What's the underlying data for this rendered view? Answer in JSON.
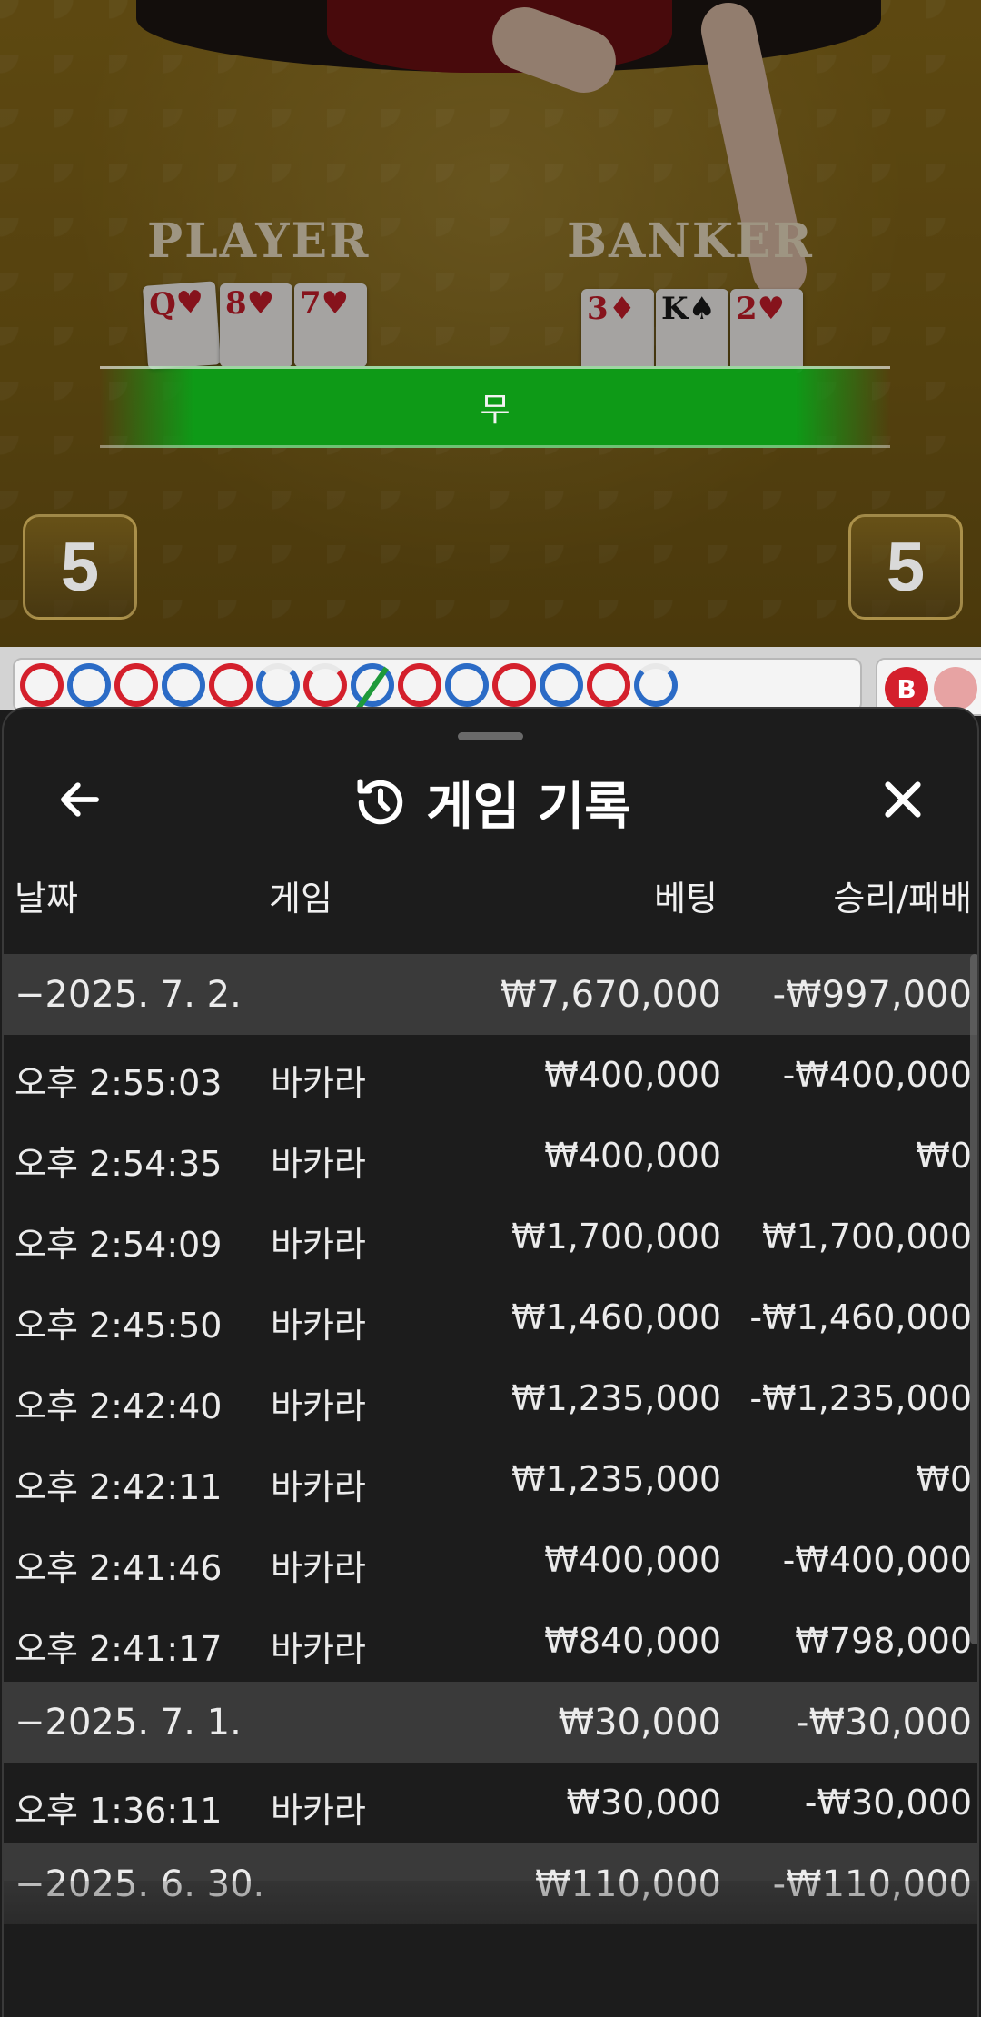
{
  "video": {
    "player_label": "PLAYER",
    "banker_label": "BANKER",
    "result_text": "무",
    "player_score": "5",
    "banker_score": "5",
    "player_cards": [
      {
        "rank": "Q",
        "suit": "♥",
        "color": "red"
      },
      {
        "rank": "8",
        "suit": "♥",
        "color": "red"
      },
      {
        "rank": "7",
        "suit": "♥",
        "color": "red"
      }
    ],
    "banker_cards": [
      {
        "rank": "3",
        "suit": "♦",
        "color": "red"
      },
      {
        "rank": "K",
        "suit": "♠",
        "color": "black"
      },
      {
        "rank": "2",
        "suit": "♥",
        "color": "red"
      }
    ]
  },
  "roadmap": {
    "beads": [
      "red",
      "blue",
      "red",
      "blue",
      "red",
      "blue-partial",
      "red-partial",
      "blue-tie",
      "red",
      "blue",
      "red",
      "blue",
      "red",
      "blue-partial"
    ],
    "chip_label": "B"
  },
  "sheet": {
    "title": "게임 기록",
    "back_icon": "arrow-left-icon",
    "title_icon": "history-icon",
    "close_icon": "close-icon",
    "headers": {
      "date": "날짜",
      "game": "게임",
      "bet": "베팅",
      "winloss": "승리/패배"
    },
    "rows": [
      {
        "type": "group",
        "date": "−2025. 7. 2.",
        "game": "",
        "bet": "₩7,670,000",
        "winloss": "-₩997,000"
      },
      {
        "type": "item",
        "date": "오후 2:55:03",
        "game": "바카라",
        "bet": "₩400,000",
        "winloss": "-₩400,000"
      },
      {
        "type": "item",
        "date": "오후 2:54:35",
        "game": "바카라",
        "bet": "₩400,000",
        "winloss": "₩0"
      },
      {
        "type": "item",
        "date": "오후 2:54:09",
        "game": "바카라",
        "bet": "₩1,700,000",
        "winloss": "₩1,700,000"
      },
      {
        "type": "item",
        "date": "오후 2:45:50",
        "game": "바카라",
        "bet": "₩1,460,000",
        "winloss": "-₩1,460,000"
      },
      {
        "type": "item",
        "date": "오후 2:42:40",
        "game": "바카라",
        "bet": "₩1,235,000",
        "winloss": "-₩1,235,000"
      },
      {
        "type": "item",
        "date": "오후 2:42:11",
        "game": "바카라",
        "bet": "₩1,235,000",
        "winloss": "₩0"
      },
      {
        "type": "item",
        "date": "오후 2:41:46",
        "game": "바카라",
        "bet": "₩400,000",
        "winloss": "-₩400,000"
      },
      {
        "type": "item",
        "date": "오후 2:41:17",
        "game": "바카라",
        "bet": "₩840,000",
        "winloss": "₩798,000"
      },
      {
        "type": "group",
        "date": "−2025. 7. 1.",
        "game": "",
        "bet": "₩30,000",
        "winloss": "-₩30,000"
      },
      {
        "type": "item",
        "date": "오후 1:36:11",
        "game": "바카라",
        "bet": "₩30,000",
        "winloss": "-₩30,000"
      },
      {
        "type": "group",
        "date": "−2025. 6. 30.",
        "game": "",
        "bet": "₩110,000",
        "winloss": "-₩110,000"
      }
    ]
  },
  "colors": {
    "result_green": "#0e9a17",
    "bead_red": "#d4202c",
    "bead_blue": "#2b6bc6",
    "sheet_bg": "#1c1c1c",
    "group_row_bg": "#3a3a3a"
  }
}
